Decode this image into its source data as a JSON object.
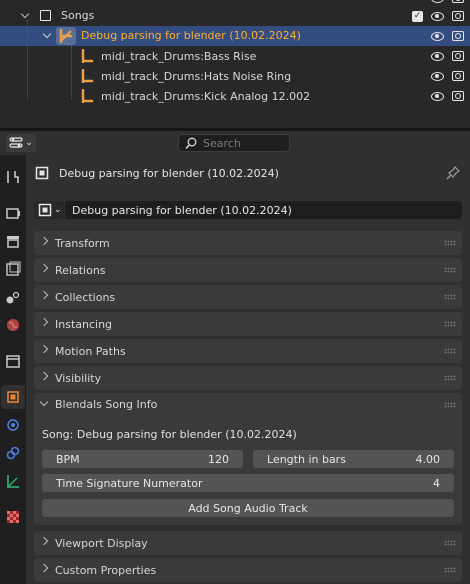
{
  "outliner": {
    "songs_label": "Songs",
    "selected_label": "Debug parsing for blender (10.02.2024)",
    "children": [
      "midi_track_Drums:Bass Rise",
      "midi_track_Drums:Hats Noise Ring",
      "midi_track_Drums:Kick Analog 12.002"
    ]
  },
  "header": {
    "search_placeholder": "Search"
  },
  "properties": {
    "object_title": "Debug parsing for blender (10.02.2024)",
    "object_name_field": "Debug parsing for blender (10.02.2024)",
    "panels": {
      "transform": "Transform",
      "relations": "Relations",
      "collections": "Collections",
      "instancing": "Instancing",
      "motion_paths": "Motion Paths",
      "visibility": "Visibility",
      "song_info": "Blendals Song Info",
      "viewport_display": "Viewport Display",
      "custom_properties": "Custom Properties"
    },
    "song_info": {
      "song_label": "Song: Debug parsing for blender (10.02.2024)",
      "bpm_label": "BPM",
      "bpm_value": "120",
      "length_label": "Length in bars",
      "length_value": "4.00",
      "time_sig_label": "Time Signature Numerator",
      "time_sig_value": "4",
      "add_audio_button": "Add Song Audio Track"
    }
  },
  "colors": {
    "selection": "#334d80",
    "bone_orange": "#e8a04a",
    "selected_text": "#ffaf29"
  }
}
